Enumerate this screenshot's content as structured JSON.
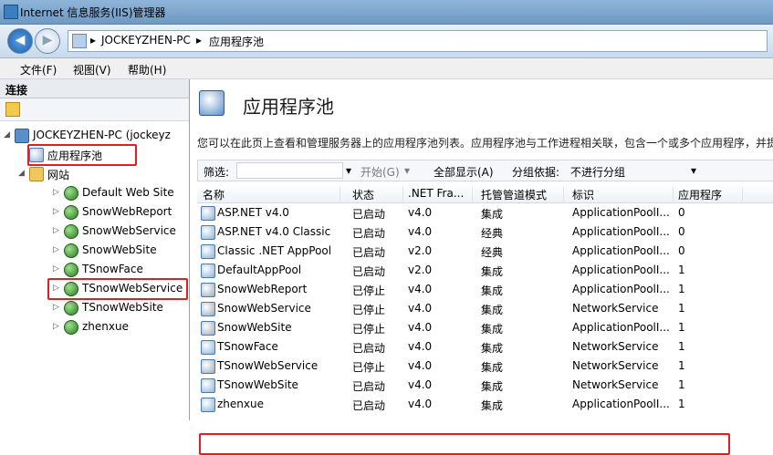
{
  "window": {
    "title": "Internet 信息服务(IIS)管理器"
  },
  "address": {
    "crumbs": [
      "JOCKEYZHEN-PC",
      "应用程序池"
    ],
    "sep": "▸"
  },
  "menu": [
    "文件(F)",
    "视图(V)",
    "帮助(H)"
  ],
  "left": {
    "header": "连接",
    "tree": [
      {
        "label": "JOCKEYZHEN-PC (jockeyz",
        "icon": "server-icon",
        "expand": "◢"
      },
      {
        "label": "应用程序池",
        "icon": "app-pool-icon",
        "expand": ""
      },
      {
        "label": "网站",
        "icon": "folder-icon",
        "expand": "◢"
      },
      {
        "label": "Default Web Site",
        "icon": "globe-icon",
        "expand": "▷"
      },
      {
        "label": "SnowWebReport",
        "icon": "globe-icon",
        "expand": "▷"
      },
      {
        "label": "SnowWebService",
        "icon": "globe-icon",
        "expand": "▷"
      },
      {
        "label": "SnowWebSite",
        "icon": "globe-icon",
        "expand": "▷"
      },
      {
        "label": "TSnowFace",
        "icon": "globe-icon",
        "expand": "▷"
      },
      {
        "label": "TSnowWebService",
        "icon": "globe-icon",
        "expand": "▷"
      },
      {
        "label": "TSnowWebSite",
        "icon": "globe-icon",
        "expand": "▷"
      },
      {
        "label": "zhenxue",
        "icon": "globe-icon",
        "expand": "▷"
      }
    ]
  },
  "main": {
    "title": "应用程序池",
    "description": "您可以在此页上查看和管理服务器上的应用程序池列表。应用程序池与工作进程相关联，包含一个或多个应用程序，并提",
    "filter": {
      "label": "筛选:",
      "start": "开始(G)",
      "show_all": "全部显示(A)",
      "group_by_label": "分组依据:",
      "group_by_value": "不进行分组"
    },
    "columns": [
      "名称",
      "状态",
      ".NET Fra...",
      "托管管道模式",
      "标识",
      "应用程序"
    ],
    "rows": [
      [
        "ASP.NET v4.0",
        "已启动",
        "v4.0",
        "集成",
        "ApplicationPoolI...",
        "0"
      ],
      [
        "ASP.NET v4.0 Classic",
        "已启动",
        "v4.0",
        "经典",
        "ApplicationPoolI...",
        "0"
      ],
      [
        "Classic .NET AppPool",
        "已启动",
        "v2.0",
        "经典",
        "ApplicationPoolI...",
        "0"
      ],
      [
        "DefaultAppPool",
        "已启动",
        "v2.0",
        "集成",
        "ApplicationPoolI...",
        "1"
      ],
      [
        "SnowWebReport",
        "已停止",
        "v4.0",
        "集成",
        "ApplicationPoolI...",
        "1"
      ],
      [
        "SnowWebService",
        "已停止",
        "v4.0",
        "集成",
        "NetworkService",
        "1"
      ],
      [
        "SnowWebSite",
        "已停止",
        "v4.0",
        "集成",
        "ApplicationPoolI...",
        "1"
      ],
      [
        "TSnowFace",
        "已启动",
        "v4.0",
        "集成",
        "NetworkService",
        "1"
      ],
      [
        "TSnowWebService",
        "已停止",
        "v4.0",
        "集成",
        "NetworkService",
        "1"
      ],
      [
        "TSnowWebSite",
        "已启动",
        "v4.0",
        "集成",
        "NetworkService",
        "1"
      ],
      [
        "zhenxue",
        "已启动",
        "v4.0",
        "集成",
        "ApplicationPoolI...",
        "1"
      ]
    ]
  },
  "colors": {
    "highlight": "#e02020",
    "titlebar": "#7ea6cf"
  }
}
